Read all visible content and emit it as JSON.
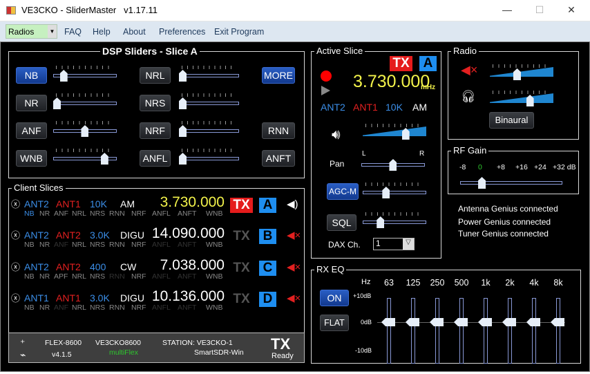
{
  "window": {
    "title": "VE3CKO - SliderMaster",
    "version": "v1.17.11",
    "minimize": "—",
    "maximize": "☐",
    "close": "✕"
  },
  "menu": {
    "radios": "Radios",
    "items": [
      "FAQ",
      "Help",
      "About",
      "Preferences",
      "Exit Program"
    ]
  },
  "dsp": {
    "title": "DSP Sliders - Slice A",
    "rows": [
      {
        "left": {
          "label": "NB",
          "value": 12,
          "active": true
        },
        "mid": {
          "label": "NRL",
          "value": 0
        },
        "right": {
          "label": "MORE",
          "active": true
        }
      },
      {
        "left": {
          "label": "NR",
          "value": 0
        },
        "mid": {
          "label": "NRS",
          "value": 0
        },
        "right": null
      },
      {
        "left": {
          "label": "ANF",
          "value": 50
        },
        "mid": {
          "label": "NRF",
          "value": 0
        },
        "right": {
          "label": "RNN"
        }
      },
      {
        "left": {
          "label": "WNB",
          "value": 85
        },
        "mid": {
          "label": "ANFL",
          "value": 0
        },
        "right": {
          "label": "ANFT"
        }
      }
    ]
  },
  "client_slices": {
    "title": "Client Slices",
    "rows": [
      {
        "ant_rx": "ANT2",
        "ant_tx": "ANT1",
        "bw": "10K",
        "mode": "AM",
        "freq": "3.730.000",
        "freq_color": "#f2f24a",
        "tx": "TX",
        "tx_active": true,
        "letter": "A",
        "audio": "on",
        "dsp": [
          [
            "NB",
            "on"
          ],
          [
            "NR",
            "off"
          ],
          [
            "ANF",
            "off"
          ],
          [
            "NRL",
            "off"
          ],
          [
            "NRS",
            "off"
          ],
          [
            "RNN",
            "off"
          ],
          [
            "NRF",
            "off"
          ],
          [
            "ANFL",
            "off"
          ],
          [
            "ANFT",
            "off"
          ],
          [
            "WNB",
            "off"
          ]
        ]
      },
      {
        "ant_rx": "ANT2",
        "ant_tx": "ANT2",
        "bw": "3.0K",
        "mode": "DIGU",
        "freq": "14.090.000",
        "freq_color": "#ffffff",
        "tx": "TX",
        "tx_active": false,
        "letter": "B",
        "audio": "muted",
        "dsp": [
          [
            "NB",
            "off"
          ],
          [
            "NR",
            "off"
          ],
          [
            "ANF",
            "dim"
          ],
          [
            "NRL",
            "off"
          ],
          [
            "NRS",
            "off"
          ],
          [
            "RNN",
            "off"
          ],
          [
            "NRF",
            "off"
          ],
          [
            "ANFL",
            "dim"
          ],
          [
            "ANFT",
            "dim"
          ],
          [
            "WNB",
            "off"
          ]
        ]
      },
      {
        "ant_rx": "ANT2",
        "ant_tx": "ANT2",
        "bw": "400",
        "mode": "CW",
        "freq": "7.038.000",
        "freq_color": "#ffffff",
        "tx": "TX",
        "tx_active": false,
        "letter": "C",
        "audio": "muted",
        "dsp": [
          [
            "NB",
            "off"
          ],
          [
            "NR",
            "off"
          ],
          [
            "APF",
            "off"
          ],
          [
            "NRL",
            "off"
          ],
          [
            "NRS",
            "off"
          ],
          [
            "RNN",
            "dim"
          ],
          [
            "NRF",
            "off"
          ],
          [
            "ANFL",
            "dim"
          ],
          [
            "ANFT",
            "dim"
          ],
          [
            "WNB",
            "off"
          ]
        ]
      },
      {
        "ant_rx": "ANT1",
        "ant_tx": "ANT1",
        "bw": "3.0K",
        "mode": "DIGU",
        "freq": "10.136.000",
        "freq_color": "#ffffff",
        "tx": "TX",
        "tx_active": false,
        "letter": "D",
        "audio": "muted",
        "dsp": [
          [
            "NB",
            "off"
          ],
          [
            "NR",
            "off"
          ],
          [
            "ANF",
            "dim"
          ],
          [
            "NRL",
            "off"
          ],
          [
            "NRS",
            "off"
          ],
          [
            "RNN",
            "off"
          ],
          [
            "NRF",
            "off"
          ],
          [
            "ANFL",
            "dim"
          ],
          [
            "ANFT",
            "dim"
          ],
          [
            "WNB",
            "off"
          ]
        ]
      }
    ]
  },
  "footer": {
    "radio_model": "FLEX-8600",
    "radio_version": "v4.1.5",
    "radio_name": "VE3CKO8600",
    "multiflex": "multiFlex",
    "station": "STATION: VE3CKO-1",
    "client": "SmartSDR-Win",
    "tx": "TX",
    "tx_status": "Ready"
  },
  "active_slice": {
    "title": "Active Slice",
    "tx": "TX",
    "letter": "A",
    "freq": "3.730.000",
    "unit": "mHz",
    "ant_rx": "ANT2",
    "ant_tx": "ANT1",
    "bw": "10K",
    "mode": "AM",
    "volume": 70,
    "pan_label": "Pan",
    "pan_l": "L",
    "pan_r": "R",
    "pan": 50,
    "agc_label": "AGC-M",
    "agc": 35,
    "sql_label": "SQL",
    "sql": 25,
    "dax_label": "DAX Ch.",
    "dax_value": "1"
  },
  "radio": {
    "title": "Radio",
    "master_volume": 42,
    "headphone_volume": 65,
    "binaural": "Binaural"
  },
  "rf_gain": {
    "title": "RF Gain",
    "ticks": [
      "-8",
      "0",
      "+8",
      "+16",
      "+24",
      "+32 dB"
    ],
    "value_db": 0
  },
  "genius": [
    "Antenna Genius connected",
    "Power Genius connected",
    "Tuner Genius connected"
  ],
  "rx_eq": {
    "title": "RX EQ",
    "on": "ON",
    "flat": "FLAT",
    "hz": "Hz",
    "top": "+10dB",
    "mid": "0dB",
    "bottom": "-10dB",
    "bands": [
      {
        "f": "63",
        "db": 0
      },
      {
        "f": "125",
        "db": 0
      },
      {
        "f": "250",
        "db": 0
      },
      {
        "f": "500",
        "db": 0
      },
      {
        "f": "1k",
        "db": 0
      },
      {
        "f": "2k",
        "db": 0
      },
      {
        "f": "4k",
        "db": 0
      },
      {
        "f": "8k",
        "db": 0
      }
    ]
  },
  "colors": {
    "blue": "#3b8ee8",
    "red": "#e32020",
    "yellow": "#f2f24a",
    "green": "#2ec82e"
  }
}
